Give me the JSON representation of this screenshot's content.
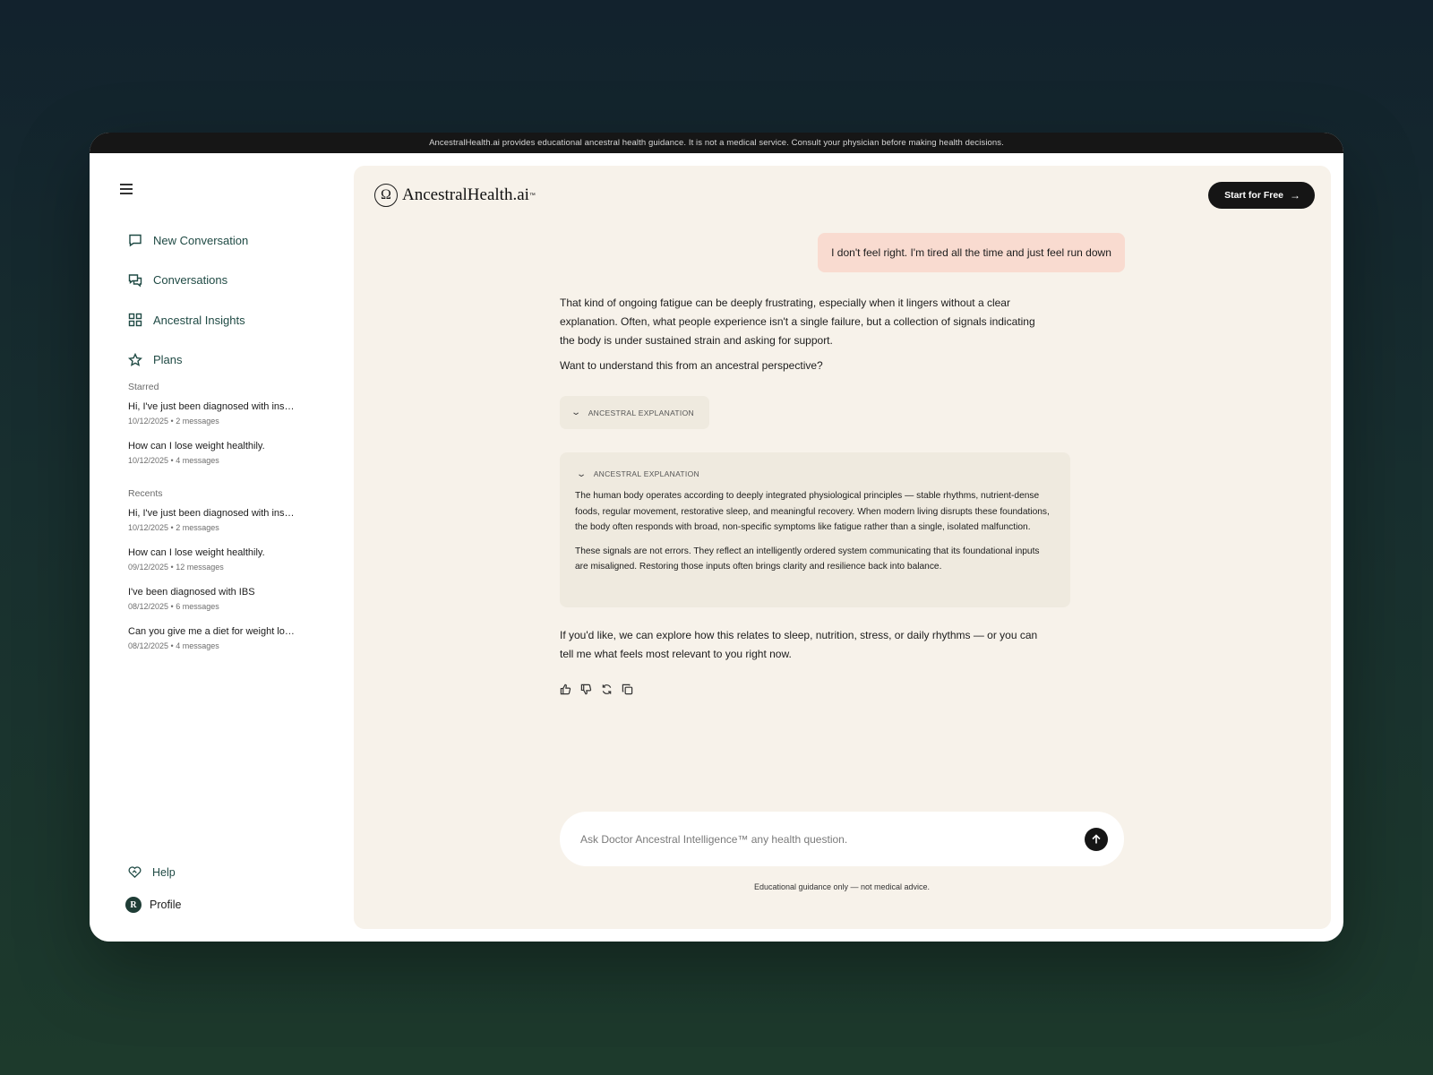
{
  "disclaimer": "AncestralHealth.ai provides educational ancestral health guidance. It is not a medical service. Consult your physician before making health decisions.",
  "sidebar": {
    "nav": [
      {
        "label": "New Conversation",
        "icon": "chat-bubble-icon"
      },
      {
        "label": "Conversations",
        "icon": "chat-bubbles-icon"
      },
      {
        "label": "Ancestral Insights",
        "icon": "grid-icon"
      },
      {
        "label": "Plans",
        "icon": "star-icon"
      }
    ],
    "starred_label": "Starred",
    "starred": [
      {
        "title": "Hi, I've just been diagnosed with insuli...",
        "meta": "10/12/2025 • 2 messages"
      },
      {
        "title": "How can I lose weight healthily.",
        "meta": "10/12/2025 • 4 messages"
      }
    ],
    "recents_label": "Recents",
    "recents": [
      {
        "title": "Hi, I've just been diagnosed with insuli...",
        "meta": "10/12/2025 • 2 messages"
      },
      {
        "title": "How can I lose weight healthily.",
        "meta": "09/12/2025 • 12 messages"
      },
      {
        "title": "I've been diagnosed with IBS",
        "meta": "08/12/2025 • 6 messages"
      },
      {
        "title": "Can you give me a diet for weight loss?",
        "meta": "08/12/2025 • 4 messages"
      }
    ],
    "help_label": "Help",
    "profile_label": "Profile",
    "profile_initial": "R"
  },
  "header": {
    "logo_mark": "Ω",
    "logo_text": "AncestralHealth.ai",
    "logo_tm": "™",
    "cta_label": "Start for Free",
    "cta_arrow": "→"
  },
  "chat": {
    "user_message": "I don't feel right. I'm tired all the time and just feel run down",
    "assistant_p1": "That kind of ongoing fatigue can be deeply frustrating, especially when it lingers without a clear explanation. Often, what people experience isn't a single failure, but a collection of signals indicating the body is under sustained strain and asking for support.",
    "assistant_p2": "Want to understand this from an ancestral perspective?",
    "explanation_label": "ANCESTRAL EXPLANATION",
    "explanation_p1": "The human body operates according to deeply integrated physiological principles — stable rhythms, nutrient-dense foods, regular movement, restorative sleep, and meaningful recovery. When modern living disrupts these foundations, the body often responds with broad, non-specific symptoms like fatigue rather than a single, isolated malfunction.",
    "explanation_p2": "These signals are not errors. They reflect an intelligently ordered system communicating that its foundational inputs are misaligned. Restoring those inputs often brings clarity and resilience back into balance.",
    "follow_up": "If you'd like, we can explore how this relates to sleep, nutrition, stress, or daily rhythms — or you can tell me what feels most relevant to you right now."
  },
  "composer": {
    "placeholder": "Ask Doctor Ancestral Intelligence™ any health question.",
    "value": ""
  },
  "footnote": "Educational guidance only — not medical advice.",
  "colors": {
    "accent_dark": "#151515",
    "sidebar_text": "#1f4a44",
    "main_bg": "#f7f2ea",
    "user_bubble": "#f9dbd0",
    "explanation_bg": "#efeadf"
  }
}
